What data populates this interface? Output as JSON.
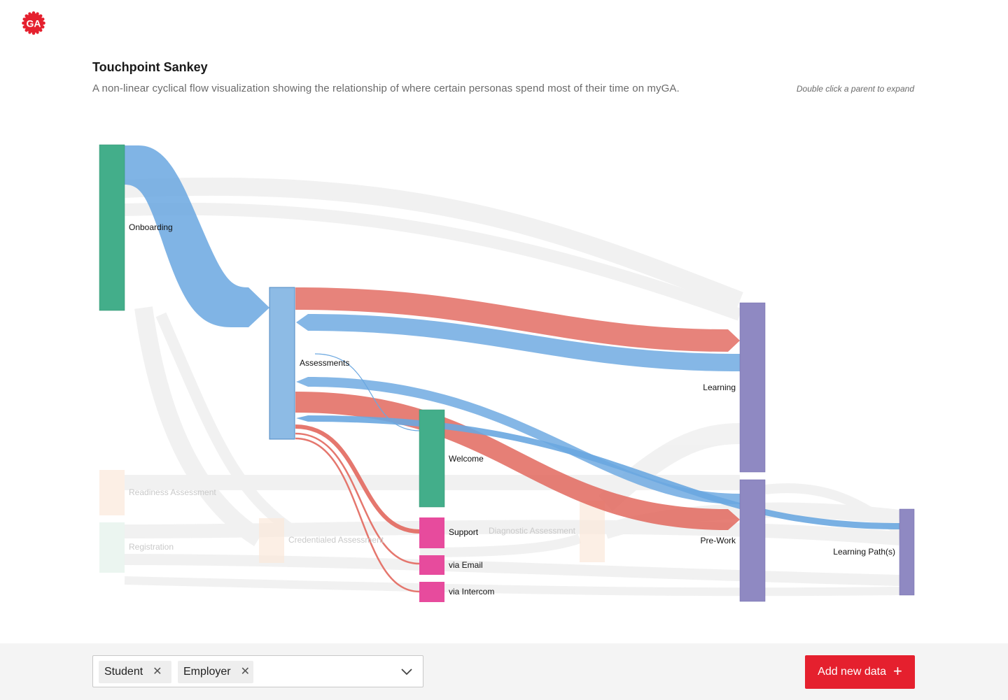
{
  "brand": {
    "logo_text": "GA",
    "logo_color": "#e5202e"
  },
  "header": {
    "title": "Touchpoint Sankey",
    "subtitle": "A non-linear cyclical flow visualization showing the relationship of where certain personas spend most of their time on myGA.",
    "hint": "Double click a parent to expand"
  },
  "chart": {
    "type": "sankey",
    "colors": {
      "green": "#43ae8a",
      "blue": "#8dbbe5",
      "purple": "#8f89c2",
      "pink": "#e74b9d",
      "red_link": "#e2685e",
      "blue_link": "#6aa7e0",
      "faded_peach": "#fbe8da",
      "faded_mint": "#e3f1ea"
    },
    "nodes": [
      {
        "id": "onboarding",
        "label": "Onboarding",
        "faded": false
      },
      {
        "id": "assessments",
        "label": "Assessments",
        "faded": false
      },
      {
        "id": "welcome",
        "label": "Welcome",
        "faded": false
      },
      {
        "id": "support",
        "label": "Support",
        "faded": false
      },
      {
        "id": "via_email",
        "label": "via Email",
        "faded": false
      },
      {
        "id": "via_intercom",
        "label": "via Intercom",
        "faded": false
      },
      {
        "id": "learning",
        "label": "Learning",
        "faded": false
      },
      {
        "id": "prework",
        "label": "Pre-Work",
        "faded": false
      },
      {
        "id": "learning_paths",
        "label": "Learning Path(s)",
        "faded": false
      },
      {
        "id": "readiness",
        "label": "Readiness Assessment",
        "faded": true
      },
      {
        "id": "registration",
        "label": "Registration",
        "faded": true
      },
      {
        "id": "credentialed",
        "label": "Credentialed Assessment",
        "faded": true
      },
      {
        "id": "diagnostic",
        "label": "Diagnostic Assessment",
        "faded": true
      }
    ],
    "links": [
      {
        "source": "onboarding",
        "target": "assessments",
        "persona": "Employer"
      },
      {
        "source": "assessments",
        "target": "learning",
        "persona": "Student"
      },
      {
        "source": "learning",
        "target": "assessments",
        "persona": "Employer"
      },
      {
        "source": "assessments",
        "target": "prework",
        "persona": "Student"
      },
      {
        "source": "prework",
        "target": "assessments",
        "persona": "Employer"
      },
      {
        "source": "assessments",
        "target": "learning_paths",
        "persona": "Employer"
      },
      {
        "source": "assessments",
        "target": "welcome",
        "persona": "Employer"
      },
      {
        "source": "assessments",
        "target": "support",
        "persona": "Student"
      },
      {
        "source": "assessments",
        "target": "via_email",
        "persona": "Student"
      },
      {
        "source": "assessments",
        "target": "via_intercom",
        "persona": "Student"
      }
    ]
  },
  "footer": {
    "filters": [
      {
        "label": "Student",
        "remove_icon": "close-icon"
      },
      {
        "label": "Employer",
        "remove_icon": "close-icon"
      }
    ],
    "dropdown_icon": "chevron-down-icon",
    "add_button": {
      "label": "Add new data",
      "icon": "plus-icon"
    }
  }
}
